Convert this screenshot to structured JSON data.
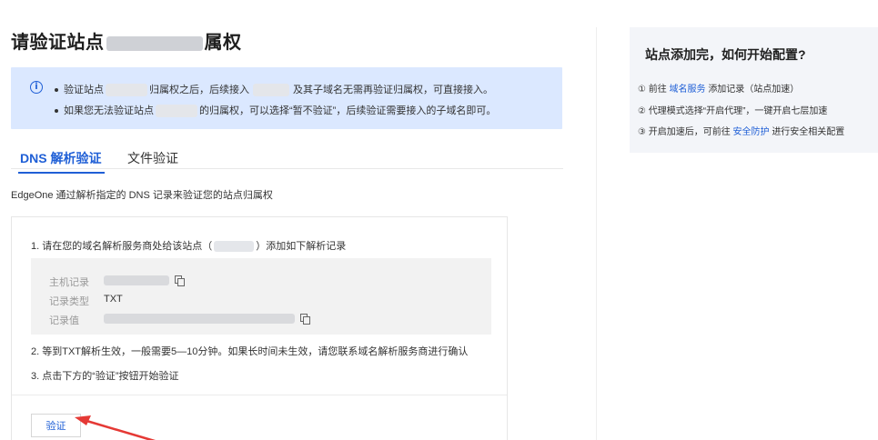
{
  "page": {
    "title_prefix": "请验证站点",
    "title_suffix": "属权"
  },
  "alert": {
    "line1_a": "验证站点",
    "line1_b": "归属权之后，后续接入",
    "line1_c": "及其子域名无需再验证归属权，可直接接入。",
    "line2_a": "如果您无法验证站点",
    "line2_b": "的归属权，可以选择“暂不验证”，后续验证需要接入的子域名即可。"
  },
  "tabs": [
    {
      "label": "DNS 解析验证"
    },
    {
      "label": "文件验证"
    }
  ],
  "description": "EdgeOne 通过解析指定的 DNS 记录来验证您的站点归属权",
  "steps": {
    "step1_a": "1. 请在您的域名解析服务商处给该站点（",
    "step1_b": "）添加如下解析记录",
    "step2": "2. 等到TXT解析生效，一般需要5—10分钟。如果长时间未生效，请您联系域名解析服务商进行确认",
    "step3": "3. 点击下方的“验证”按钮开始验证"
  },
  "record": {
    "host_label": "主机记录",
    "type_label": "记录类型",
    "type_value": "TXT",
    "value_label": "记录值"
  },
  "verify_button": "验证",
  "side_panel": {
    "title": "站点添加完，如何开始配置?",
    "line1_a": "① 前往",
    "line1_link": "域名服务",
    "line1_b": "添加记录（站点加速）",
    "line2": "② 代理模式选择“开启代理”，一键开启七层加速",
    "line3_a": "③ 开启加速后，可前往",
    "line3_link": "安全防护",
    "line3_b": "进行安全相关配置"
  },
  "colors": {
    "accent": "#1f5fd6",
    "alert_bg": "#dbe8ff",
    "arrow": "#e53935"
  }
}
